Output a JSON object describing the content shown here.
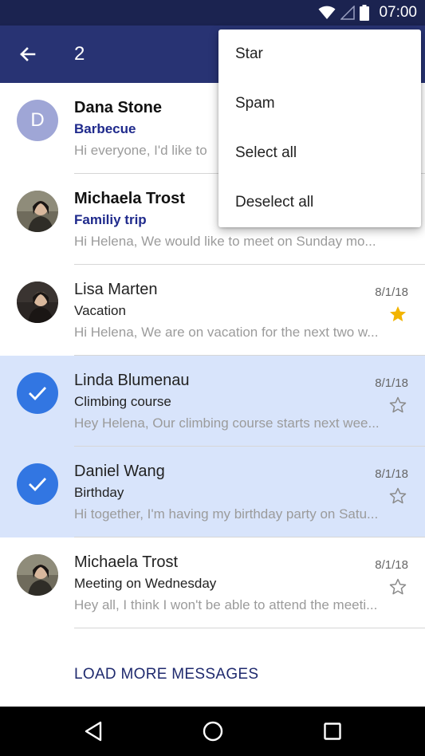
{
  "status_bar": {
    "time": "07:00"
  },
  "app_bar": {
    "back_icon": "arrow-left-icon",
    "selected_count": "2"
  },
  "messages": [
    {
      "avatar_type": "letter",
      "avatar_letter": "D",
      "sender": "Dana Stone",
      "subject": "Barbecue",
      "preview": "Hi everyone, I'd like to",
      "date": "",
      "unread": true,
      "selected": false,
      "starred": false
    },
    {
      "avatar_type": "photo",
      "sender": "Michaela Trost",
      "subject": "Familiy trip",
      "preview": "Hi Helena, We would like to meet on Sunday mo...",
      "date": "",
      "unread": true,
      "selected": false,
      "starred": false
    },
    {
      "avatar_type": "photo",
      "sender": "Lisa Marten",
      "subject": "Vacation",
      "preview": "Hi Helena, We are on vacation for the next two w...",
      "date": "8/1/18",
      "unread": false,
      "selected": false,
      "starred": true
    },
    {
      "avatar_type": "check",
      "sender": "Linda Blumenau",
      "subject": "Climbing course",
      "preview": "Hey Helena, Our climbing course starts next wee...",
      "date": "8/1/18",
      "unread": false,
      "selected": true,
      "starred": false
    },
    {
      "avatar_type": "check",
      "sender": "Daniel Wang",
      "subject": "Birthday",
      "preview": "Hi together, I'm having my birthday party on Satu...",
      "date": "8/1/18",
      "unread": false,
      "selected": true,
      "starred": false
    },
    {
      "avatar_type": "photo",
      "sender": "Michaela Trost",
      "subject": "Meeting on Wednesday",
      "preview": "Hey all, I think I won't be able to attend the meeti...",
      "date": "8/1/18",
      "unread": false,
      "selected": false,
      "starred": false
    }
  ],
  "load_more_label": "LOAD MORE MESSAGES",
  "overflow_menu": {
    "items": [
      "Star",
      "Spam",
      "Select all",
      "Deselect all"
    ]
  },
  "colors": {
    "app_bar": "#283373",
    "status_bar": "#1b2350",
    "selected_row": "#d8e4fb",
    "check_avatar": "#3276e2",
    "star_filled": "#f2b400",
    "unread_subject": "#1f2a8c"
  },
  "nav_bar": {
    "icons": [
      "back-triangle-icon",
      "home-circle-icon",
      "recents-square-icon"
    ]
  }
}
